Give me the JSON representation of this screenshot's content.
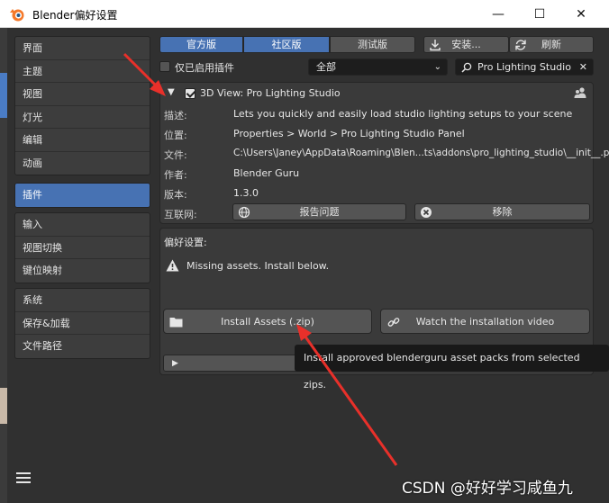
{
  "window": {
    "title": "Blender偏好设置",
    "minimize_glyph": "—",
    "maximize_glyph": "☐",
    "close_glyph": "✕"
  },
  "sidebar": {
    "group1": [
      "界面",
      "主题",
      "视图",
      "灯光",
      "编辑",
      "动画"
    ],
    "active": "插件",
    "group2": [
      "输入",
      "视图切换",
      "键位映射"
    ],
    "group3": [
      "系统",
      "保存&加载",
      "文件路径"
    ]
  },
  "tabs": [
    "官方版",
    "社区版",
    "测试版"
  ],
  "toolbar": {
    "install_label": "安装...",
    "refresh_label": "刷新",
    "enabled_only_label": "仅已启用插件",
    "category_value": "全部",
    "search_value": "Pro Lighting Studio"
  },
  "addon": {
    "name": "3D View: Pro Lighting Studio",
    "fields": [
      {
        "label": "描述:",
        "value": "Lets you quickly and easily load studio lighting setups to your scene"
      },
      {
        "label": "位置:",
        "value": "Properties > World > Pro Lighting Studio Panel"
      },
      {
        "label": "文件:",
        "value": "C:\\Users\\Janey\\AppData\\Roaming\\Blen...ts\\addons\\pro_lighting_studio\\__init__.py"
      },
      {
        "label": "作者:",
        "value": "Blender Guru"
      },
      {
        "label": "版本:",
        "value": "1.3.0"
      }
    ],
    "internet_label": "互联网:",
    "report_label": "报告问题",
    "remove_label": "移除"
  },
  "prefs": {
    "title": "偏好设置:",
    "warning": "Missing assets. Install below.",
    "install_assets_label": "Install Assets (.zip)",
    "watch_video_label": "Watch the installation video",
    "tooltip": "Install approved blenderguru asset packs from selected zips."
  },
  "watermark": "CSDN @好好学习咸鱼九",
  "colors": {
    "accent": "#4772b3",
    "arrow": "#e8302a"
  }
}
